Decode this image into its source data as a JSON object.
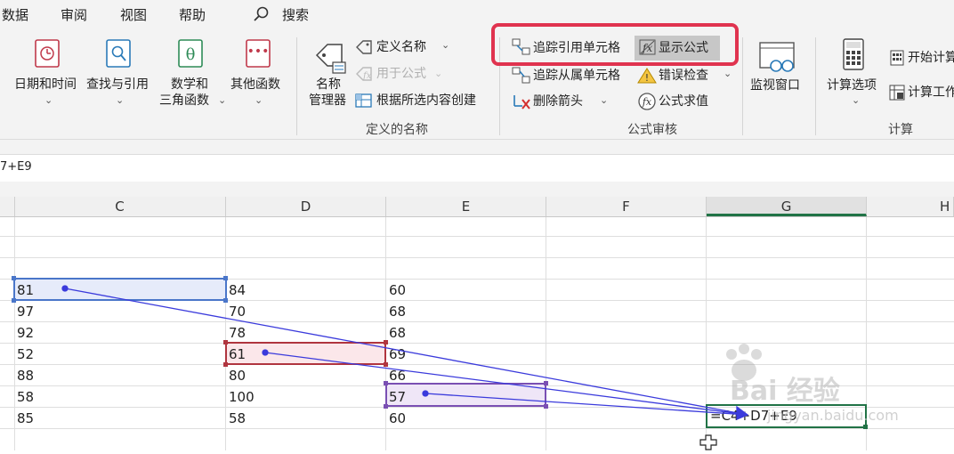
{
  "tabs": [
    "数据",
    "审阅",
    "视图",
    "帮助"
  ],
  "search_label": "搜索",
  "ribbon": {
    "func_lib": {
      "date_time": "日期和时间",
      "lookup": "查找与引用",
      "math_line1": "数学和",
      "math_line2": "三角函数",
      "other": "其他函数"
    },
    "defined_names": {
      "name_manager_line1": "名称",
      "name_manager_line2": "管理器",
      "define_name": "定义名称",
      "use_in_formula": "用于公式",
      "create_from_selection": "根据所选内容创建",
      "group_label": "定义的名称"
    },
    "auditing": {
      "trace_precedents": "追踪引用单元格",
      "show_formulas": "显示公式",
      "trace_dependents": "追踪从属单元格",
      "error_checking": "错误检查",
      "remove_arrows": "删除箭头",
      "evaluate_formula": "公式求值",
      "watch_window": "监视窗口",
      "group_label": "公式审核"
    },
    "calculation": {
      "calc_options": "计算选项",
      "calc_now": "开始计算",
      "calc_sheet": "计算工作表",
      "group_label": "计算"
    }
  },
  "formula_bar_text": "7+E9",
  "columns": [
    "C",
    "D",
    "E",
    "F",
    "G",
    "H"
  ],
  "col_c": [
    "81",
    "97",
    "92",
    "52",
    "88",
    "58",
    "85"
  ],
  "col_d": [
    "84",
    "70",
    "78",
    "61",
    "80",
    "100",
    "58"
  ],
  "col_e": [
    "60",
    "68",
    "68",
    "69",
    "66",
    "57",
    "60"
  ],
  "g9_formula": "=C4+D7+E9",
  "watermark": "Bai 经验",
  "watermark_url": "jingyan.baidu.com",
  "colors": {
    "ribbon_bg": "#f3f3f3",
    "highlight_red": "#e0334f",
    "trace_blue": "#3b3bdc",
    "excel_green": "#217346"
  }
}
